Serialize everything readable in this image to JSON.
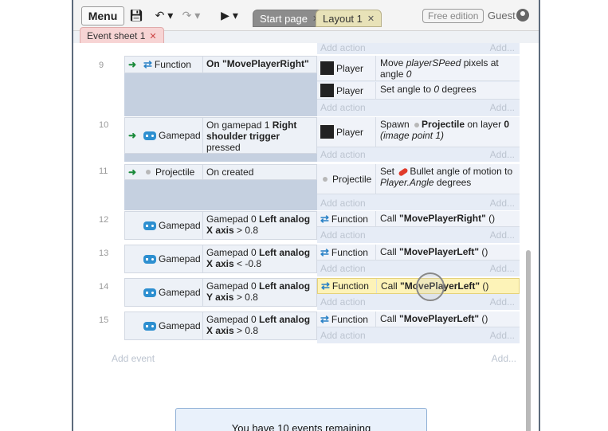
{
  "toolbar": {
    "menu_label": "Menu",
    "tabs": [
      {
        "label": "Start page"
      },
      {
        "label": "Layout 1"
      }
    ],
    "free_edition": "Free edition",
    "guest": "Guest"
  },
  "sheet_tab": {
    "label": "Event sheet 1"
  },
  "events": [
    {
      "num": "9",
      "cond_object": "Function",
      "cond_text": "On \"MovePlayerRight\"",
      "actions": [
        {
          "object": "Player",
          "text_a": "Move ",
          "text_b": "playerSPeed",
          "text_c": " pixels at angle ",
          "text_d": "0"
        },
        {
          "object": "Player",
          "text_a": "Set angle to ",
          "text_b": "0",
          "text_c": " degrees"
        }
      ]
    },
    {
      "num": "10",
      "cond_object": "Gamepad",
      "cond_text_a": "On gamepad 1 ",
      "cond_text_b": "Right shoulder trigger",
      "cond_text_c": " pressed",
      "actions": [
        {
          "object": "Player",
          "text_a": "Spawn ",
          "text_b": "Projectile",
          "text_c": " on layer ",
          "text_d": "0",
          "text_e": "(image point 1)"
        }
      ]
    },
    {
      "num": "11",
      "cond_object": "Projectile",
      "cond_text": "On created",
      "actions": [
        {
          "object": "Projectile",
          "text_a": "Set ",
          "text_b": "Bullet",
          "text_c": " angle of motion to ",
          "text_d": "Player.Angle",
          "text_e": " degrees"
        }
      ]
    },
    {
      "num": "12",
      "cond_object": "Gamepad",
      "cond_text_a": "Gamepad 0 ",
      "cond_text_b": "Left analog X axis",
      "cond_text_c": " > 0.8",
      "actions": [
        {
          "object": "Function",
          "text_a": "Call ",
          "text_b": "\"MovePlayerRight\"",
          "text_c": " ()"
        }
      ]
    },
    {
      "num": "13",
      "cond_object": "Gamepad",
      "cond_text_a": "Gamepad 0 ",
      "cond_text_b": "Left analog X axis",
      "cond_text_c": " < -0.8",
      "actions": [
        {
          "object": "Function",
          "text_a": "Call ",
          "text_b": "\"MovePlayerLeft\"",
          "text_c": " ()"
        }
      ]
    },
    {
      "num": "14",
      "cond_object": "Gamepad",
      "cond_text_a": "Gamepad 0 ",
      "cond_text_b": "Left analog Y axis",
      "cond_text_c": " > 0.8",
      "actions": [
        {
          "object": "Function",
          "text_a": "Call ",
          "text_b": "\"MovePlayerLeft\"",
          "text_c": " ()"
        }
      ]
    },
    {
      "num": "15",
      "cond_object": "Gamepad",
      "cond_text_a": "Gamepad 0 ",
      "cond_text_b": "Left analog X axis",
      "cond_text_c": " > 0.8",
      "actions": [
        {
          "object": "Function",
          "text_a": "Call ",
          "text_b": "\"MovePlayerLeft\"",
          "text_c": " ()"
        }
      ]
    }
  ],
  "labels": {
    "add_action": "Add action",
    "add_more": "Add...",
    "add_event": "Add event"
  },
  "remaining": "You have 10 events remaining",
  "colors": {
    "accent": "#2a82c6",
    "highlight": "#fdf3b8",
    "condition_bg": "#edf1f7"
  }
}
